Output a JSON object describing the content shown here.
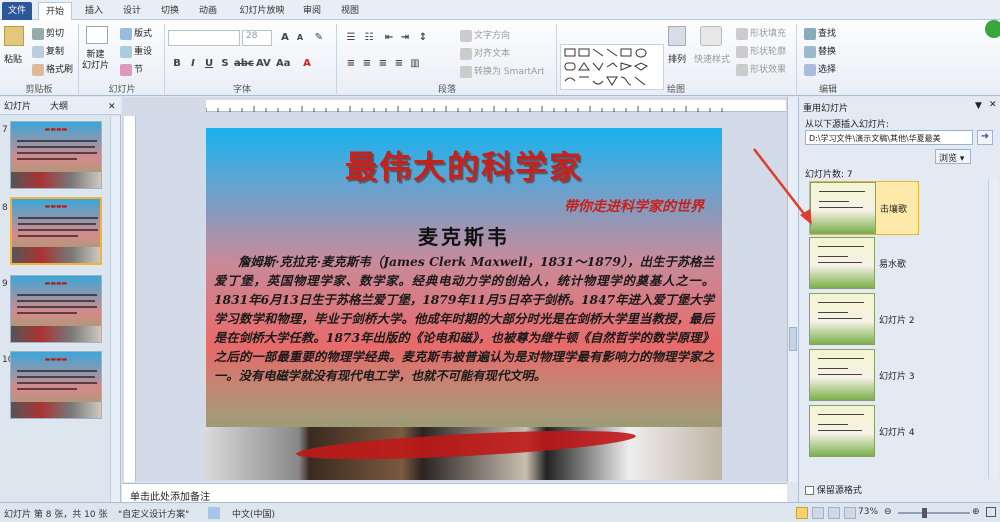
{
  "tabs": [
    "文件",
    "开始",
    "插入",
    "设计",
    "切换",
    "动画",
    "幻灯片放映",
    "审阅",
    "视图"
  ],
  "ribbon": {
    "clipboard": {
      "paste": "粘贴",
      "cut": "剪切",
      "copy": "复制",
      "format_painter": "格式刷",
      "label": "剪贴板"
    },
    "slides": {
      "new_slide": "新建\n幻灯片",
      "layout": "版式",
      "reset": "重设",
      "section": "节",
      "label": "幻灯片"
    },
    "font": {
      "font_size": "28",
      "label": "字体"
    },
    "paragraph": {
      "text_direction": "文字方向",
      "align_text": "对齐文本",
      "convert_smartart": "转换为 SmartArt",
      "label": "段落"
    },
    "drawing": {
      "arrange": "排列",
      "quick_styles": "快速样式",
      "shape_fill": "形状填充",
      "shape_outline": "形状轮廓",
      "shape_effects": "形状效果",
      "label": "绘图"
    },
    "editing": {
      "find": "查找",
      "replace": "替换",
      "select": "选择",
      "label": "编辑"
    }
  },
  "left_panel": {
    "tabs": [
      "幻灯片",
      "大纲"
    ],
    "slides": [
      {
        "num": "7"
      },
      {
        "num": "8"
      },
      {
        "num": "9"
      },
      {
        "num": "10"
      }
    ]
  },
  "slide": {
    "title": "最伟大的科学家",
    "subtitle": "带你走进科学家的世界",
    "heading": "麦克斯韦",
    "body": "詹姆斯·克拉克·麦克斯韦（James Clerk Maxwell，1831～1879），出生于苏格兰爱丁堡，英国物理学家、数学家。经典电动力学的创始人，统计物理学的奠基人之一。1831年6月13日生于苏格兰爱丁堡，1879年11月5日卒于剑桥。1847年进入爱丁堡大学学习数学和物理，毕业于剑桥大学。他成年时期的大部分时光是在剑桥大学里当教授，最后是在剑桥大学任教。1873年出版的《论电和磁》，也被尊为继牛顿《自然哲学的数学原理》之后的一部最重要的物理学经典。麦克斯韦被普遍认为是对物理学最有影响力的物理学家之一。没有电磁学就没有现代电工学，也就不可能有现代文明。"
  },
  "notes_placeholder": "单击此处添加备注",
  "right_pane": {
    "title": "重用幻灯片",
    "insert_from_label": "从以下源插入幻灯片:",
    "path": "D:\\学习文件\\演示文稿\\其他\\华夏最美",
    "browse": "浏览",
    "count_label": "幻灯片数: 7",
    "items": [
      {
        "label": "击壤歌"
      },
      {
        "label": "易水歌"
      },
      {
        "label": "幻灯片 2"
      },
      {
        "label": "幻灯片 3"
      },
      {
        "label": "幻灯片 4"
      }
    ],
    "keep_format": "保留源格式"
  },
  "status": {
    "slide_info": "幻灯片 第 8 张，共 10 张",
    "theme": "\"自定义设计方案\"",
    "language": "中文(中国)",
    "zoom": "73%"
  },
  "colors": {
    "accent": "#2b579a",
    "title_red": "#c8201a",
    "selection": "#f3b23a"
  }
}
